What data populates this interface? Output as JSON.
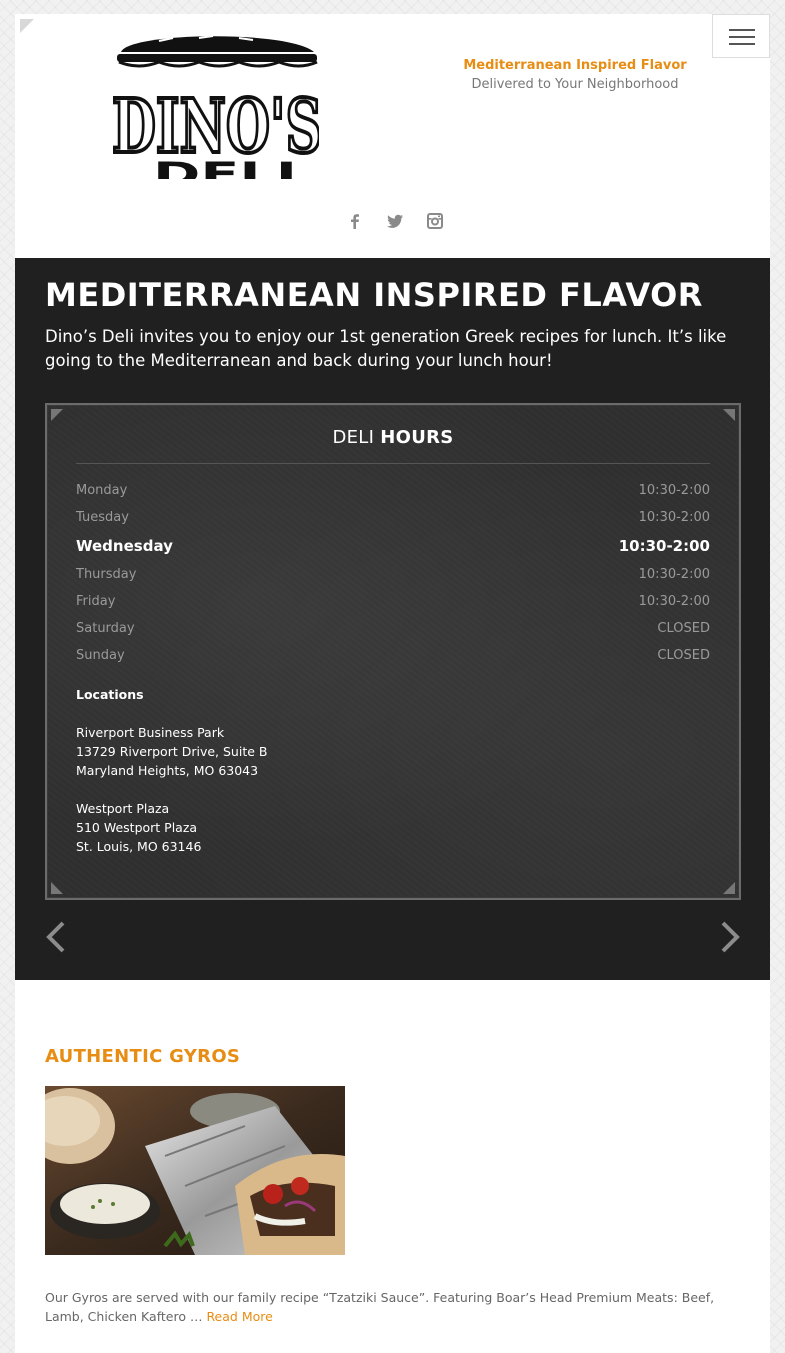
{
  "header": {
    "logo_text_top": "DINO'S",
    "logo_text_bottom": "DELI",
    "tagline_title": "Mediterranean Inspired Flavor",
    "tagline_subtitle": "Delivered to Your Neighborhood",
    "social": [
      {
        "icon": "facebook-icon",
        "glyph": "f"
      },
      {
        "icon": "twitter-icon",
        "glyph": "t"
      },
      {
        "icon": "instagram-icon",
        "glyph": "◙"
      }
    ]
  },
  "hero": {
    "title": "MEDITERRANEAN INSPIRED FLAVOR",
    "intro": "Dino’s Deli invites you to enjoy our 1st generation Greek recipes for lunch. It’s like going to the Mediterranean and back during your lunch hour!"
  },
  "hours": {
    "title_light": "DELI",
    "title_bold": "HOURS",
    "days": [
      {
        "day": "Monday",
        "time": "10:30-2:00",
        "today": false
      },
      {
        "day": "Tuesday",
        "time": "10:30-2:00",
        "today": false
      },
      {
        "day": "Wednesday",
        "time": "10:30-2:00",
        "today": true
      },
      {
        "day": "Thursday",
        "time": "10:30-2:00",
        "today": false
      },
      {
        "day": "Friday",
        "time": "10:30-2:00",
        "today": false
      },
      {
        "day": "Saturday",
        "time": "CLOSED",
        "today": false
      },
      {
        "day": "Sunday",
        "time": "CLOSED",
        "today": false
      }
    ],
    "locations_heading": "Locations",
    "locations": [
      {
        "name": "Riverport Business Park",
        "street": "13729 Riverport Drive, Suite B",
        "city": "Maryland Heights, MO 63043"
      },
      {
        "name": "Westport Plaza",
        "street": "510 Westport Plaza",
        "city": "St. Louis, MO 63146"
      }
    ]
  },
  "feature": {
    "title": "AUTHENTIC GYROS",
    "description": "Our Gyros are served with our family recipe “Tzatziki Sauce”. Featuring Boar’s Head Premium Meats: Beef, Lamb, Chicken Kaftero …",
    "read_more": "Read More"
  },
  "colors": {
    "accent": "#e88d14",
    "hero_bg": "#202021",
    "board_bg": "#2f2f2f"
  }
}
